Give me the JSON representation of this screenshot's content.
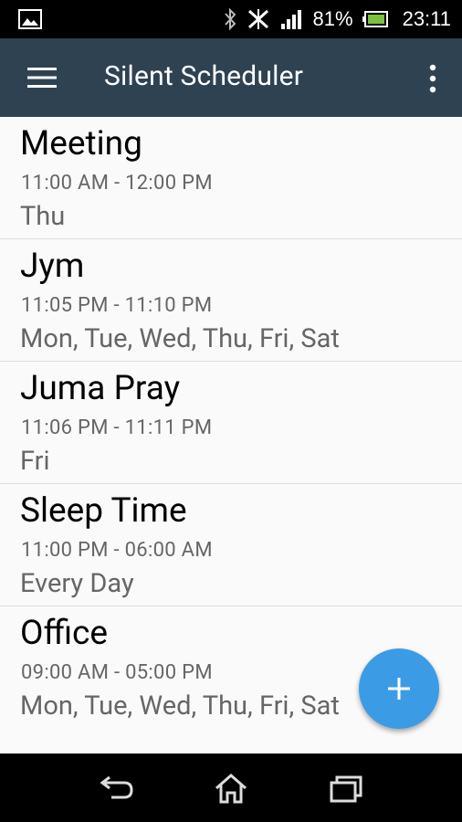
{
  "status_bar": {
    "icons": [
      "gallery-icon",
      "bluetooth-icon",
      "no-network-icon",
      "signal-icon",
      "battery-icon"
    ],
    "battery_percent": "81%",
    "time": "23:11"
  },
  "app_bar": {
    "title": "Silent Scheduler",
    "menu_icon": "hamburger-menu-icon",
    "overflow_icon": "more-vert-icon"
  },
  "schedules": [
    {
      "name": "Meeting",
      "time_range": "11:00 AM - 12:00 PM",
      "days": "Thu"
    },
    {
      "name": "Jym",
      "time_range": "11:05 PM - 11:10 PM",
      "days": "Mon, Tue, Wed, Thu, Fri, Sat"
    },
    {
      "name": "Juma Pray",
      "time_range": "11:06 PM - 11:11 PM",
      "days": "Fri"
    },
    {
      "name": "Sleep Time",
      "time_range": "11:00 PM - 06:00 AM",
      "days": "Every Day"
    },
    {
      "name": "Office",
      "time_range": "09:00 AM - 05:00 PM",
      "days": "Mon, Tue, Wed, Thu, Fri, Sat"
    }
  ],
  "fab": {
    "icon": "plus-icon",
    "color": "#3b9ce5"
  },
  "nav_bar": {
    "icons": [
      "back-icon",
      "home-icon",
      "recent-apps-icon"
    ]
  },
  "colors": {
    "app_bar": "#2f4252",
    "list_bg": "#fafafa"
  }
}
